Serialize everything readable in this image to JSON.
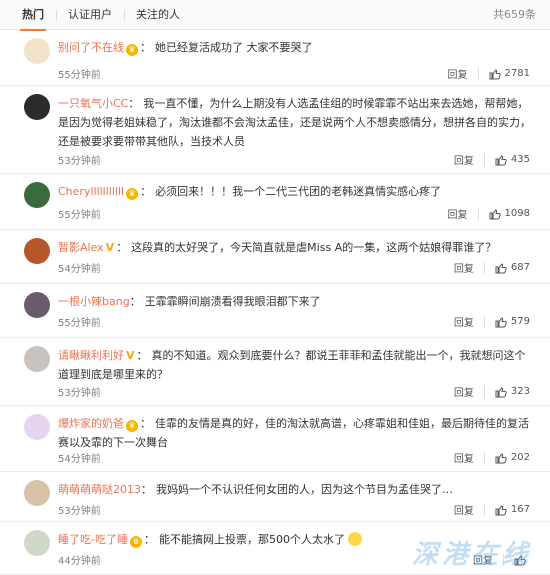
{
  "tabs": [
    {
      "label": "热门"
    },
    {
      "label": "认证用户"
    },
    {
      "label": "关注的人"
    }
  ],
  "total": "共659条",
  "action_labels": {
    "reply": "回复"
  },
  "comments": [
    {
      "user": "别问了不在线",
      "badge": "crown",
      "text": "她已经复活成功了 大家不要哭了",
      "time": "55分钟前",
      "likes": "2781"
    },
    {
      "user": "一只氧气小CC",
      "badge": "none",
      "text": "我一直不懂，为什么上期没有人选孟佳组的时候霏霏不站出来去选她，帮帮她，是因为觉得老姐妹稳了，淘汰谁都不会淘汰孟佳，还是说两个人不想卖感情分，想拼各自的实力，还是被要求要带带其他队，当技术人员",
      "time": "53分钟前",
      "likes": "435"
    },
    {
      "user": "Cherylllllllllll",
      "badge": "crown",
      "text": "必须回来！！！我一个二代三代团的老韩迷真情实感心疼了",
      "time": "55分钟前",
      "likes": "1098"
    },
    {
      "user": "暂影Alex",
      "badge": "v",
      "text": "这段真的太好哭了，今天简直就是虐Miss A的一集，这两个姑娘得罪谁了？",
      "time": "54分钟前",
      "likes": "687"
    },
    {
      "user": "一根小辣bang",
      "badge": "none",
      "text": "王霏霏瞬间崩溃看得我眼泪都下来了",
      "time": "55分钟前",
      "likes": "579"
    },
    {
      "user": "请瞅瞅利利好",
      "badge": "v",
      "text": "真的不知道。观众到底要什么？都说王菲菲和孟佳就能出一个，我就想问这个道理到底是哪里来的？",
      "time": "53分钟前",
      "likes": "323"
    },
    {
      "user": "爆炸家的奶爸",
      "badge": "crown",
      "text": "佳霏的友情是真的好，佳的淘汰就高谱，心疼霏姐和佳姐，最后期待佳的复活赛以及霏的下一次舞台",
      "time": "54分钟前",
      "likes": "202"
    },
    {
      "user": "萌萌萌萌哒2013",
      "badge": "none",
      "text": "我妈妈一个不认识任何女团的人，因为这个节目为孟佳哭了…",
      "time": "53分钟前",
      "likes": "167"
    },
    {
      "user": "睡了吃-吃了睡",
      "badge": "crown",
      "text": "能不能搞网上投票，那500个人太水了",
      "time": "44分钟前",
      "likes": "",
      "emoji": "smile-emoji"
    }
  ],
  "watermark": "深港在线",
  "colors": {
    "accent": "#f77c1d",
    "username": "#eb7350",
    "time": "#808080"
  }
}
